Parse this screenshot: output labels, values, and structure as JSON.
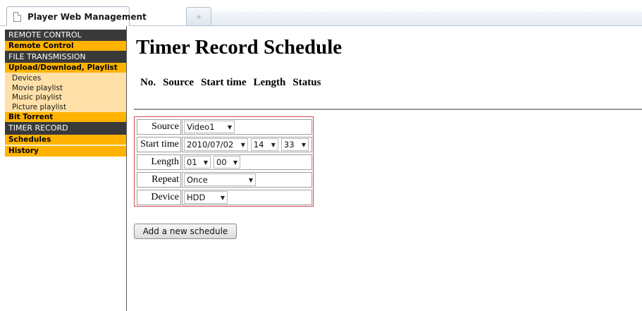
{
  "browser": {
    "tab_title": "Player Web Management",
    "new_tab_glyph": "+"
  },
  "sidebar": {
    "sections": [
      {
        "header": "REMOTE CONTROL",
        "items": [
          "Remote Control"
        ]
      },
      {
        "header": "FILE TRANSMISSION",
        "items": [
          "Upload/Download, Playlist"
        ],
        "sub_items": [
          "Devices",
          "Movie playlist",
          "Music playlist",
          "Picture playlist"
        ],
        "after_items": [
          "Bit Torrent"
        ]
      },
      {
        "header": "TIMER RECORD",
        "items": [
          "Schedules",
          "History"
        ]
      }
    ]
  },
  "main": {
    "title": "Timer Record Schedule",
    "columns": [
      "No.",
      "Source",
      "Start time",
      "Length",
      "Status"
    ],
    "form": {
      "source": {
        "label": "Source",
        "value": "Video1"
      },
      "start_time": {
        "label": "Start time",
        "date": "2010/07/02",
        "hour": "14",
        "minute": "33"
      },
      "length": {
        "label": "Length",
        "hours": "01",
        "minutes": "00"
      },
      "repeat": {
        "label": "Repeat",
        "value": "Once"
      },
      "device": {
        "label": "Device",
        "value": "HDD"
      }
    },
    "add_button": "Add a new schedule"
  },
  "colors": {
    "nav_header_bg": "#393939",
    "nav_item_bg": "#ffb300",
    "nav_sub_bg": "#ffe0a8",
    "form_border": "#d94a58"
  }
}
